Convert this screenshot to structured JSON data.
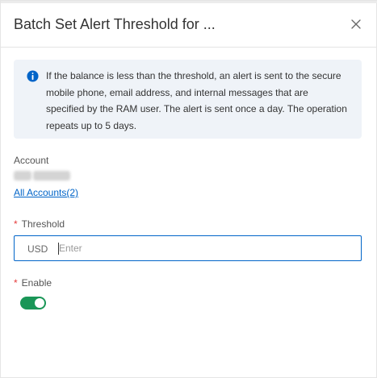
{
  "dialog": {
    "title": "Batch Set Alert Threshold for ..."
  },
  "notice": {
    "icon": "info-icon",
    "accent_color": "#0064c8",
    "text": "If the balance is less than the threshold, an alert is sent to the secure mobile phone, email address, and internal messages that are specified by the RAM user. The alert is sent once a day. The operation repeats up to 5 days."
  },
  "account": {
    "label": "Account",
    "link": "All Accounts(2)"
  },
  "threshold": {
    "required_mark": "*",
    "label": "Threshold",
    "currency": "USD",
    "placeholder": "Enter",
    "value": ""
  },
  "enable": {
    "required_mark": "*",
    "label": "Enable",
    "on": true,
    "color": "#1a9657"
  }
}
